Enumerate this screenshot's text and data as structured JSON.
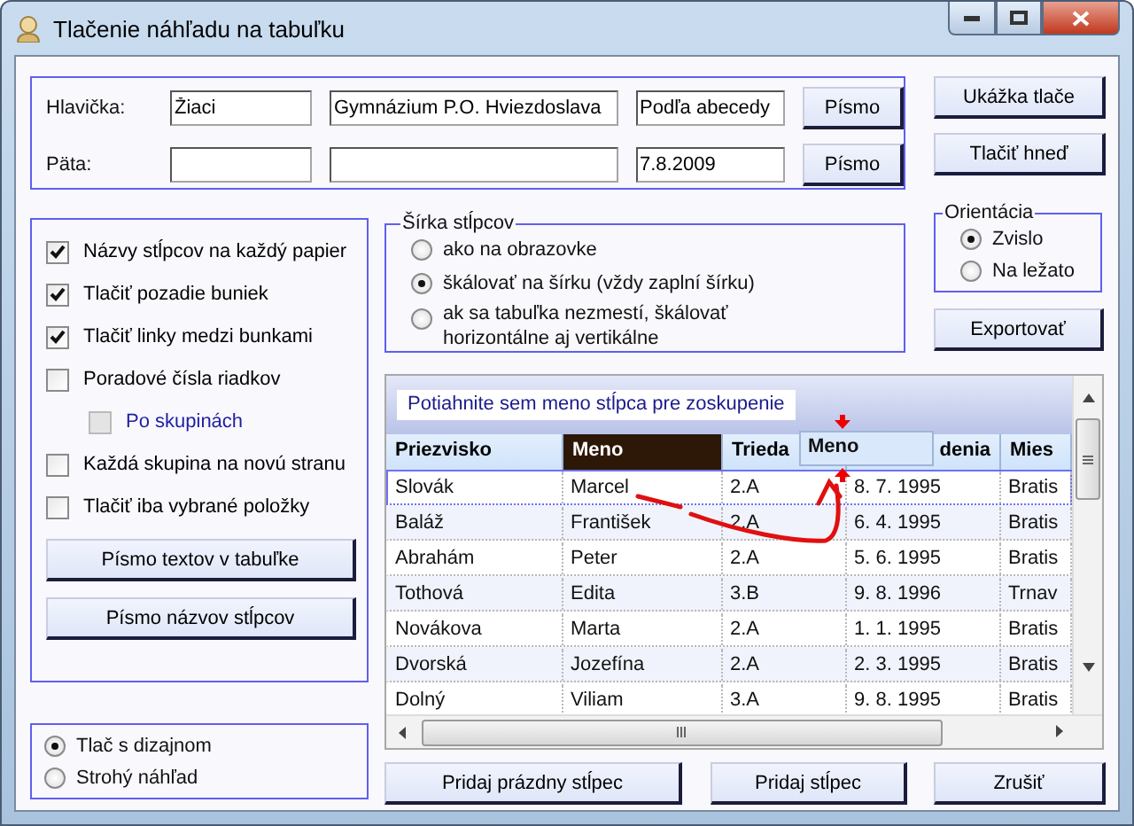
{
  "window": {
    "title": "Tlačenie náhľadu na tabuľku"
  },
  "header_footer": [
    {
      "label": "Hlavička:",
      "fields": [
        {
          "kind": "text",
          "value": "Žiaci"
        },
        {
          "kind": "text",
          "value": "Gymnázium P.O. Hviezdoslava"
        },
        {
          "kind": "text",
          "value": "Podľa abecedy"
        }
      ],
      "button": "Písmo"
    },
    {
      "label": "Päta:",
      "fields": [
        {
          "kind": "blank"
        },
        {
          "kind": "blank"
        },
        {
          "kind": "text",
          "value": "7.8.2009"
        }
      ],
      "button": "Písmo"
    }
  ],
  "side_buttons": [
    "Ukážka tlače",
    "Tlačiť hneď"
  ],
  "options": [
    {
      "label": "Názvy stĺpcov na každý papier",
      "checked": true,
      "disabled": false
    },
    {
      "label": "Tlačiť pozadie buniek",
      "checked": true,
      "disabled": false
    },
    {
      "label": "Tlačiť linky medzi bunkami",
      "checked": true,
      "disabled": false
    },
    {
      "label": "Poradové čísla riadkov",
      "checked": false,
      "disabled": false,
      "children": [
        {
          "label": "Po skupinách",
          "checked": false,
          "disabled": true
        }
      ]
    },
    {
      "label": "Každá skupina na novú stranu",
      "checked": false,
      "disabled": false
    },
    {
      "label": "Tlačiť iba vybrané položky",
      "checked": false,
      "disabled": false
    }
  ],
  "font_buttons": [
    "Písmo textov v tabuľke",
    "Písmo názvov stĺpcov"
  ],
  "print_mode": [
    {
      "label": "Tlač s dizajnom",
      "selected": true
    },
    {
      "label": "Strohý náhľad",
      "selected": false
    }
  ],
  "column_width": {
    "title": "Šírka stĺpcov",
    "options": [
      {
        "label": "ako na obrazovke",
        "selected": false
      },
      {
        "label": "škálovať na šírku (vždy zaplní šírku)",
        "selected": true
      },
      {
        "label": "ak sa tabuľka nezmestí, škálovať horizontálne aj vertikálne",
        "selected": false
      }
    ]
  },
  "orientation": {
    "title": "Orientácia",
    "options": [
      {
        "label": "Zvislo",
        "selected": true
      },
      {
        "label": "Na ležato",
        "selected": false
      }
    ]
  },
  "export_button": "Exportovať",
  "grid": {
    "group_hint": "Potiahnite sem meno stĺpca pre zoskupenie",
    "drag_column": "Meno",
    "columns": [
      {
        "label": "Priezvisko",
        "selected": false
      },
      {
        "label": "Meno",
        "selected": true
      },
      {
        "label": "Trieda",
        "selected": false
      },
      {
        "label": "denia",
        "selected": false
      },
      {
        "label": "Mies",
        "selected": false
      }
    ],
    "rows": [
      {
        "cells": [
          "Slovák",
          "Marcel",
          "2.A",
          "8. 7. 1995",
          "Bratis"
        ],
        "selected": true
      },
      {
        "cells": [
          "Baláž",
          "František",
          "2.A",
          "6. 4. 1995",
          "Bratis"
        ],
        "selected": false
      },
      {
        "cells": [
          "Abrahám",
          "Peter",
          "2.A",
          "5. 6. 1995",
          "Bratis"
        ],
        "selected": false
      },
      {
        "cells": [
          "Tothová",
          "Edita",
          "3.B",
          "9. 8. 1996",
          "Trnav"
        ],
        "selected": false
      },
      {
        "cells": [
          "Novákova",
          "Marta",
          "2.A",
          "1. 1. 1995",
          "Bratis"
        ],
        "selected": false
      },
      {
        "cells": [
          "Dvorská",
          "Jozefína",
          "2.A",
          "2. 3. 1995",
          "Bratis"
        ],
        "selected": false
      },
      {
        "cells": [
          "Dolný",
          "Viliam",
          "3.A",
          "9. 8. 1995",
          "Bratis"
        ],
        "selected": false
      }
    ]
  },
  "bottom_buttons": [
    "Pridaj prázdny stĺpec",
    "Pridaj stĺpec",
    "Zrušiť"
  ]
}
